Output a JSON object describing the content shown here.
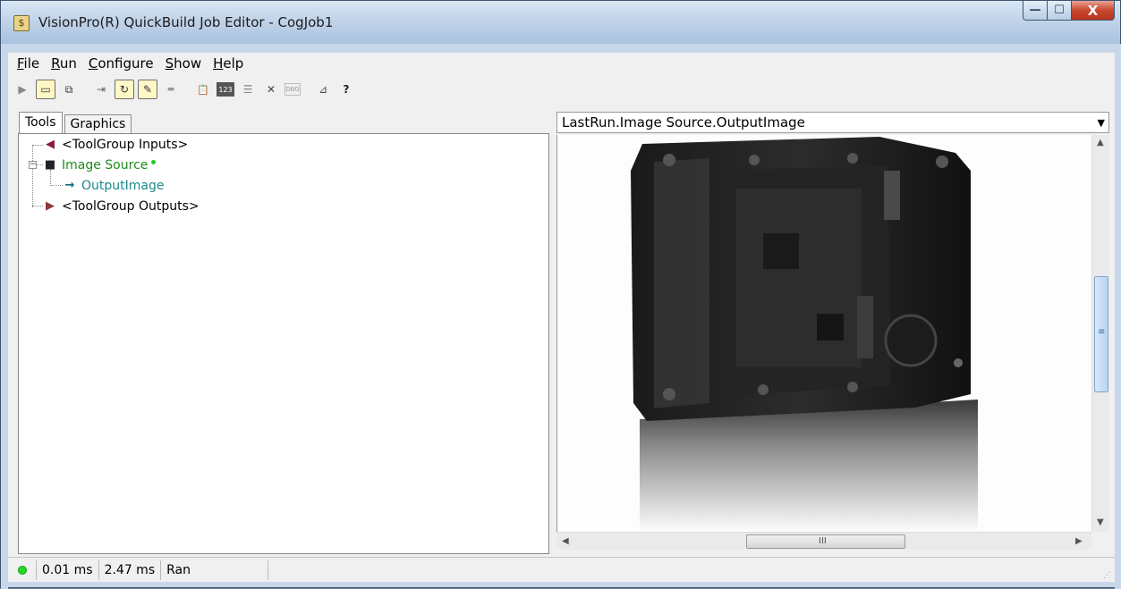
{
  "window": {
    "title": "VisionPro(R) QuickBuild Job Editor - CogJob1",
    "title_icon": "job-editor-icon",
    "controls": {
      "minimize": "—",
      "maximize": "☐",
      "close": "X"
    }
  },
  "menu": [
    {
      "label": "File",
      "accel": "F",
      "rest": "ile"
    },
    {
      "label": "Run",
      "accel": "R",
      "rest": "un"
    },
    {
      "label": "Configure",
      "accel": "C",
      "rest": "onfigure"
    },
    {
      "label": "Show",
      "accel": "S",
      "rest": "how"
    },
    {
      "label": "Help",
      "accel": "H",
      "rest": "elp"
    }
  ],
  "toolbar": {
    "buttons": [
      {
        "name": "run-icon",
        "glyph": "▶"
      },
      {
        "name": "image-display-icon",
        "glyph": "▭"
      },
      {
        "name": "tool-display-icon",
        "glyph": "⧉"
      },
      {
        "name": "reset-icon",
        "glyph": "⇥"
      },
      {
        "name": "live-mode-icon",
        "glyph": "↻"
      },
      {
        "name": "edit-icon",
        "glyph": "✎"
      },
      {
        "name": "dash-icon",
        "glyph": "▬"
      },
      {
        "name": "clipboard-icon",
        "glyph": "📋"
      },
      {
        "name": "numeric-icon",
        "glyph": "123"
      },
      {
        "name": "results-icon",
        "glyph": "☰"
      },
      {
        "name": "tools-icon",
        "glyph": "✕"
      },
      {
        "name": "debug-icon",
        "glyph": "DBG"
      },
      {
        "name": "ruler-icon",
        "glyph": "⊿"
      },
      {
        "name": "help-icon",
        "glyph": "?"
      }
    ]
  },
  "tabs": [
    {
      "label": "Tools",
      "active": true
    },
    {
      "label": "Graphics",
      "active": false
    }
  ],
  "tree": [
    {
      "label": "<ToolGroup Inputs>",
      "color": "#000000",
      "icon_color": "#8b1a4a"
    },
    {
      "label": "Image Source",
      "color": "#1e8c1e",
      "icon_color": "#222222",
      "status_dot": "#22cc22"
    },
    {
      "label": "OutputImage",
      "color": "#1e8a8a",
      "icon_color": "#106b7a"
    },
    {
      "label": "<ToolGroup Outputs>",
      "color": "#000000",
      "icon_color": "#8b3a3a"
    }
  ],
  "image_view": {
    "selector": "LastRun.Image Source.OutputImage",
    "hscroll_grip": "III",
    "vscroll_grip": "≡"
  },
  "status": {
    "led_color": "#23d923",
    "time1": "0.01 ms",
    "time2": "2.47 ms",
    "state": "Ran"
  }
}
